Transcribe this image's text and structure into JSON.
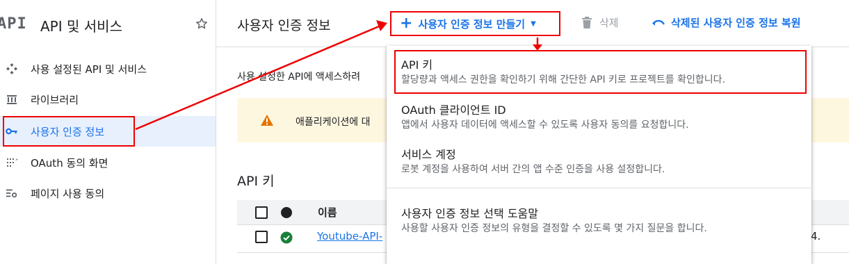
{
  "sidebar": {
    "logo_text": "API",
    "title": "API 및 서비스",
    "items": [
      {
        "label": "사용 설정된 API 및 서비스",
        "icon": "enabled-apis-icon"
      },
      {
        "label": "라이브러리",
        "icon": "library-icon"
      },
      {
        "label": "사용자 인증 정보",
        "icon": "key-icon",
        "active": true
      },
      {
        "label": "OAuth 동의 화면",
        "icon": "oauth-consent-icon"
      },
      {
        "label": "페이지 사용 동의",
        "icon": "page-consent-icon"
      }
    ]
  },
  "header": {
    "title": "사용자 인증 정보",
    "create_label": "사용자 인증 정보 만들기",
    "delete_label": "삭제",
    "restore_label": "삭제된 사용자 인증 정보 복원"
  },
  "main": {
    "description": "사용 설정한 API에 액세스하려",
    "warning_text": "애플리케이션에 대",
    "api_keys_title": "API 키",
    "table": {
      "col_name": "이름",
      "rows": [
        {
          "name": "Youtube-API-",
          "tail": "4."
        }
      ]
    }
  },
  "menu": {
    "items": [
      {
        "title": "API 키",
        "desc": "할당량과 액세스 권한을 확인하기 위해 간단한 API 키로 프로젝트를 확인합니다."
      },
      {
        "title": "OAuth 클라이언트 ID",
        "desc": "앱에서 사용자 데이터에 액세스할 수 있도록 사용자 동의를 요청합니다."
      },
      {
        "title": "서비스 계정",
        "desc": "로봇 계정을 사용하여 서버 간의 앱 수준 인증을 사용 설정합니다."
      },
      {
        "title": "사용자 인증 정보 선택 도움말",
        "desc": "사용할 사용자 인증 정보의 유형을 결정할 수 있도록 몇 가지 질문을 합니다."
      }
    ]
  },
  "colors": {
    "accent": "#1a73e8",
    "annotation": "#ee0000",
    "warning": "#e37400",
    "success": "#188038"
  }
}
